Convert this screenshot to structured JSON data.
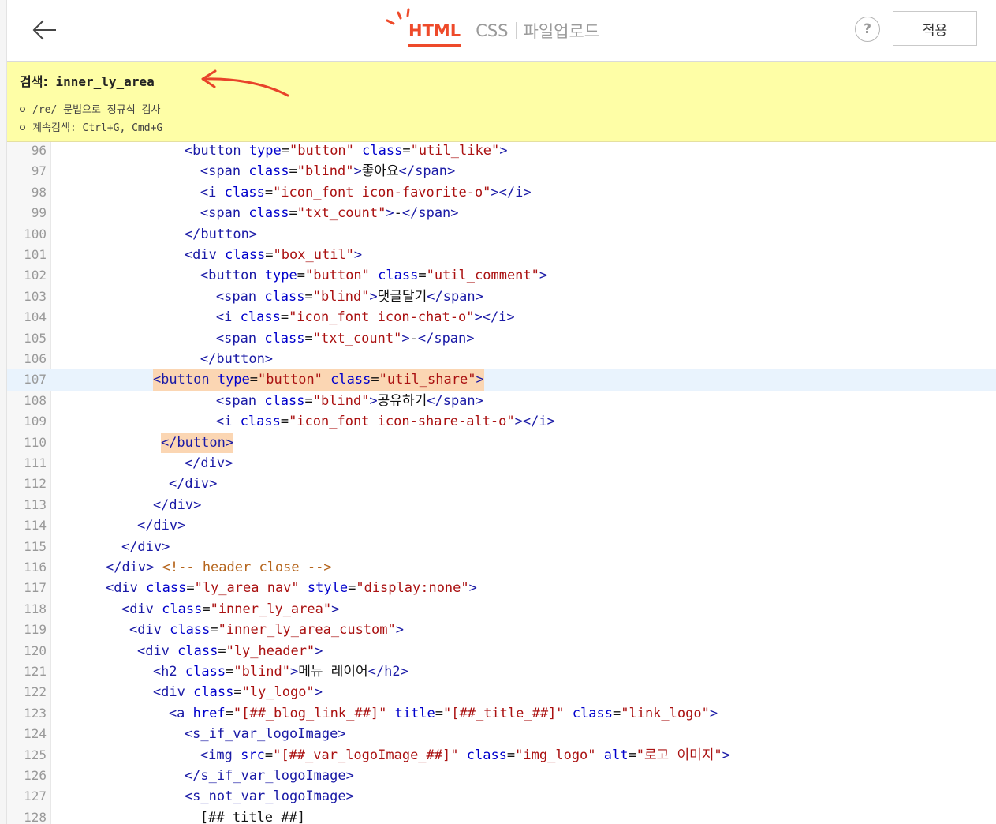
{
  "toolbar": {
    "tabs": [
      {
        "label": "HTML",
        "active": true
      },
      {
        "label": "CSS",
        "active": false
      },
      {
        "label": "파일업로드",
        "active": false
      }
    ],
    "help_label": "?",
    "apply_label": "적용",
    "accent_color": "#ee4a2a"
  },
  "search": {
    "label": "검색:",
    "query": "inner_ly_area",
    "hints": [
      "/re/ 문법으로 정규식 검사",
      "계속검색: Ctrl+G, Cmd+G"
    ],
    "background_color": "#fefea6"
  },
  "editor": {
    "current_line": 107,
    "lines": [
      {
        "n": "96",
        "indent": 16,
        "tokens": [
          [
            "t",
            "<button "
          ],
          [
            "a",
            "type"
          ],
          [
            "x",
            "="
          ],
          [
            "s",
            "\"button\""
          ],
          [
            "x",
            " "
          ],
          [
            "a",
            "class"
          ],
          [
            "x",
            "="
          ],
          [
            "s",
            "\"util_like\""
          ],
          [
            "t",
            ">"
          ]
        ]
      },
      {
        "n": "97",
        "indent": 18,
        "tokens": [
          [
            "t",
            "<span "
          ],
          [
            "a",
            "class"
          ],
          [
            "x",
            "="
          ],
          [
            "s",
            "\"blind\""
          ],
          [
            "t",
            ">"
          ],
          [
            "x",
            "좋아요"
          ],
          [
            "t",
            "</span>"
          ]
        ]
      },
      {
        "n": "98",
        "indent": 18,
        "tokens": [
          [
            "t",
            "<i "
          ],
          [
            "a",
            "class"
          ],
          [
            "x",
            "="
          ],
          [
            "s",
            "\"icon_font icon-favorite-o\""
          ],
          [
            "t",
            "></i>"
          ]
        ]
      },
      {
        "n": "99",
        "indent": 18,
        "tokens": [
          [
            "t",
            "<span "
          ],
          [
            "a",
            "class"
          ],
          [
            "x",
            "="
          ],
          [
            "s",
            "\"txt_count\""
          ],
          [
            "t",
            ">"
          ],
          [
            "x",
            "-"
          ],
          [
            "t",
            "</span>"
          ]
        ]
      },
      {
        "n": "100",
        "indent": 16,
        "tokens": [
          [
            "t",
            "</button>"
          ]
        ]
      },
      {
        "n": "101",
        "indent": 16,
        "tokens": [
          [
            "t",
            "<div "
          ],
          [
            "a",
            "class"
          ],
          [
            "x",
            "="
          ],
          [
            "s",
            "\"box_util\""
          ],
          [
            "t",
            ">"
          ]
        ]
      },
      {
        "n": "102",
        "indent": 18,
        "tokens": [
          [
            "t",
            "<button "
          ],
          [
            "a",
            "type"
          ],
          [
            "x",
            "="
          ],
          [
            "s",
            "\"button\""
          ],
          [
            "x",
            " "
          ],
          [
            "a",
            "class"
          ],
          [
            "x",
            "="
          ],
          [
            "s",
            "\"util_comment\""
          ],
          [
            "t",
            ">"
          ]
        ]
      },
      {
        "n": "103",
        "indent": 20,
        "tokens": [
          [
            "t",
            "<span "
          ],
          [
            "a",
            "class"
          ],
          [
            "x",
            "="
          ],
          [
            "s",
            "\"blind\""
          ],
          [
            "t",
            ">"
          ],
          [
            "x",
            "댓글달기"
          ],
          [
            "t",
            "</span>"
          ]
        ]
      },
      {
        "n": "104",
        "indent": 20,
        "tokens": [
          [
            "t",
            "<i "
          ],
          [
            "a",
            "class"
          ],
          [
            "x",
            "="
          ],
          [
            "s",
            "\"icon_font icon-chat-o\""
          ],
          [
            "t",
            "></i>"
          ]
        ]
      },
      {
        "n": "105",
        "indent": 20,
        "tokens": [
          [
            "t",
            "<span "
          ],
          [
            "a",
            "class"
          ],
          [
            "x",
            "="
          ],
          [
            "s",
            "\"txt_count\""
          ],
          [
            "t",
            ">"
          ],
          [
            "x",
            "-"
          ],
          [
            "t",
            "</span>"
          ]
        ]
      },
      {
        "n": "106",
        "indent": 18,
        "tokens": [
          [
            "t",
            "</button>"
          ]
        ]
      },
      {
        "n": "107",
        "indent": 12,
        "highlight": true,
        "tokens": [
          [
            "t",
            "<button "
          ],
          [
            "a",
            "type"
          ],
          [
            "x",
            "="
          ],
          [
            "s",
            "\"button\""
          ],
          [
            "x",
            " "
          ],
          [
            "a",
            "class"
          ],
          [
            "x",
            "="
          ],
          [
            "s",
            "\"util_share\""
          ],
          [
            "t",
            ">"
          ]
        ]
      },
      {
        "n": "108",
        "indent": 20,
        "tokens": [
          [
            "t",
            "<span "
          ],
          [
            "a",
            "class"
          ],
          [
            "x",
            "="
          ],
          [
            "s",
            "\"blind\""
          ],
          [
            "t",
            ">"
          ],
          [
            "x",
            "공유하기"
          ],
          [
            "t",
            "</span>"
          ]
        ]
      },
      {
        "n": "109",
        "indent": 20,
        "tokens": [
          [
            "t",
            "<i "
          ],
          [
            "a",
            "class"
          ],
          [
            "x",
            "="
          ],
          [
            "s",
            "\"icon_font icon-share-alt-o\""
          ],
          [
            "t",
            "></i>"
          ]
        ]
      },
      {
        "n": "110",
        "indent": 13,
        "highlight": true,
        "tokens": [
          [
            "t",
            "</button>"
          ]
        ]
      },
      {
        "n": "111",
        "indent": 16,
        "tokens": [
          [
            "t",
            "</div>"
          ]
        ]
      },
      {
        "n": "112",
        "indent": 14,
        "tokens": [
          [
            "t",
            "</div>"
          ]
        ]
      },
      {
        "n": "113",
        "indent": 12,
        "tokens": [
          [
            "t",
            "</div>"
          ]
        ]
      },
      {
        "n": "114",
        "indent": 10,
        "tokens": [
          [
            "t",
            "</div>"
          ]
        ]
      },
      {
        "n": "115",
        "indent": 8,
        "tokens": [
          [
            "t",
            "</div>"
          ]
        ]
      },
      {
        "n": "116",
        "indent": 6,
        "tokens": [
          [
            "t",
            "</div>"
          ],
          [
            "x",
            " "
          ],
          [
            "c",
            "<!-- header close -->"
          ]
        ]
      },
      {
        "n": "117",
        "indent": 6,
        "tokens": [
          [
            "t",
            "<div "
          ],
          [
            "a",
            "class"
          ],
          [
            "x",
            "="
          ],
          [
            "s",
            "\"ly_area nav\""
          ],
          [
            "x",
            " "
          ],
          [
            "a",
            "style"
          ],
          [
            "x",
            "="
          ],
          [
            "s",
            "\"display:none\""
          ],
          [
            "t",
            ">"
          ]
        ]
      },
      {
        "n": "118",
        "indent": 8,
        "tokens": [
          [
            "t",
            "<div "
          ],
          [
            "a",
            "class"
          ],
          [
            "x",
            "="
          ],
          [
            "s",
            "\"inner_ly_area\""
          ],
          [
            "t",
            ">"
          ]
        ]
      },
      {
        "n": "119",
        "indent": 9,
        "tokens": [
          [
            "t",
            "<div "
          ],
          [
            "a",
            "class"
          ],
          [
            "x",
            "="
          ],
          [
            "s",
            "\"inner_ly_area_custom\""
          ],
          [
            "t",
            ">"
          ]
        ]
      },
      {
        "n": "120",
        "indent": 10,
        "tokens": [
          [
            "t",
            "<div "
          ],
          [
            "a",
            "class"
          ],
          [
            "x",
            "="
          ],
          [
            "s",
            "\"ly_header\""
          ],
          [
            "t",
            ">"
          ]
        ]
      },
      {
        "n": "121",
        "indent": 12,
        "tokens": [
          [
            "t",
            "<h2 "
          ],
          [
            "a",
            "class"
          ],
          [
            "x",
            "="
          ],
          [
            "s",
            "\"blind\""
          ],
          [
            "t",
            ">"
          ],
          [
            "x",
            "메뉴 레이어"
          ],
          [
            "t",
            "</h2>"
          ]
        ]
      },
      {
        "n": "122",
        "indent": 12,
        "tokens": [
          [
            "t",
            "<div "
          ],
          [
            "a",
            "class"
          ],
          [
            "x",
            "="
          ],
          [
            "s",
            "\"ly_logo\""
          ],
          [
            "t",
            ">"
          ]
        ]
      },
      {
        "n": "123",
        "indent": 14,
        "tokens": [
          [
            "t",
            "<a "
          ],
          [
            "a",
            "href"
          ],
          [
            "x",
            "="
          ],
          [
            "s",
            "\"[##_blog_link_##]\""
          ],
          [
            "x",
            " "
          ],
          [
            "a",
            "title"
          ],
          [
            "x",
            "="
          ],
          [
            "s",
            "\"[##_title_##]\""
          ],
          [
            "x",
            " "
          ],
          [
            "a",
            "class"
          ],
          [
            "x",
            "="
          ],
          [
            "s",
            "\"link_logo\""
          ],
          [
            "t",
            ">"
          ]
        ]
      },
      {
        "n": "124",
        "indent": 16,
        "tokens": [
          [
            "t",
            "<s_if_var_logoImage>"
          ]
        ]
      },
      {
        "n": "125",
        "indent": 18,
        "tokens": [
          [
            "t",
            "<img "
          ],
          [
            "a",
            "src"
          ],
          [
            "x",
            "="
          ],
          [
            "s",
            "\"[##_var_logoImage_##]\""
          ],
          [
            "x",
            " "
          ],
          [
            "a",
            "class"
          ],
          [
            "x",
            "="
          ],
          [
            "s",
            "\"img_logo\""
          ],
          [
            "x",
            " "
          ],
          [
            "a",
            "alt"
          ],
          [
            "x",
            "="
          ],
          [
            "s",
            "\"로고 이미지\""
          ],
          [
            "t",
            ">"
          ]
        ]
      },
      {
        "n": "126",
        "indent": 16,
        "tokens": [
          [
            "t",
            "</s_if_var_logoImage>"
          ]
        ]
      },
      {
        "n": "127",
        "indent": 16,
        "tokens": [
          [
            "t",
            "<s_not_var_logoImage>"
          ]
        ]
      },
      {
        "n": "128",
        "indent": 18,
        "tokens": [
          [
            "x",
            "[##_title_##]"
          ]
        ]
      }
    ]
  }
}
